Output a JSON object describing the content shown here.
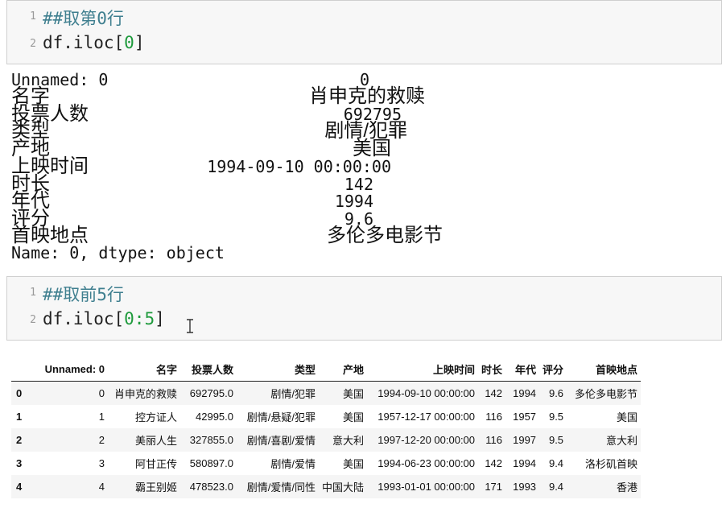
{
  "cell1": {
    "line1_num": "1",
    "line1_code": "##取第0行",
    "line2_num": "2",
    "line2_prefix": "df.iloc[",
    "line2_arg": "0",
    "line2_suffix": "]"
  },
  "series_output": {
    "header_key": "Unnamed: 0",
    "header_val": "0",
    "rows": [
      {
        "key": "名字",
        "value": "肖申克的救赎"
      },
      {
        "key": "投票人数",
        "value": "692795"
      },
      {
        "key": "类型",
        "value": "剧情/犯罪"
      },
      {
        "key": "产地",
        "value": "美国"
      },
      {
        "key": "上映时间",
        "value": "1994-09-10 00:00:00"
      },
      {
        "key": "时长",
        "value": "142"
      },
      {
        "key": "年代",
        "value": "1994"
      },
      {
        "key": "评分",
        "value": "9.6"
      },
      {
        "key": "首映地点",
        "value": "多伦多电影节"
      }
    ],
    "footer": "Name: 0, dtype: object"
  },
  "cell2": {
    "line1_num": "1",
    "line1_code": "##取前5行",
    "line2_num": "2",
    "line2_prefix": "df.iloc[",
    "line2_arg": "0:5",
    "line2_suffix": "]"
  },
  "dataframe": {
    "columns": [
      "",
      "Unnamed: 0",
      "名字",
      "投票人数",
      "类型",
      "产地",
      "上映时间",
      "时长",
      "年代",
      "评分",
      "首映地点"
    ],
    "rows": [
      [
        "0",
        "0",
        "肖申克的救赎",
        "692795.0",
        "剧情/犯罪",
        "美国",
        "1994-09-10 00:00:00",
        "142",
        "1994",
        "9.6",
        "多伦多电影节"
      ],
      [
        "1",
        "1",
        "控方证人",
        "42995.0",
        "剧情/悬疑/犯罪",
        "美国",
        "1957-12-17 00:00:00",
        "116",
        "1957",
        "9.5",
        "美国"
      ],
      [
        "2",
        "2",
        "美丽人生",
        "327855.0",
        "剧情/喜剧/爱情",
        "意大利",
        "1997-12-20 00:00:00",
        "116",
        "1997",
        "9.5",
        "意大利"
      ],
      [
        "3",
        "3",
        "阿甘正传",
        "580897.0",
        "剧情/爱情",
        "美国",
        "1994-06-23 00:00:00",
        "142",
        "1994",
        "9.4",
        "洛杉矶首映"
      ],
      [
        "4",
        "4",
        "霸王别姬",
        "478523.0",
        "剧情/爱情/同性",
        "中国大陆",
        "1993-01-01 00:00:00",
        "171",
        "1993",
        "9.4",
        "香港"
      ]
    ]
  }
}
